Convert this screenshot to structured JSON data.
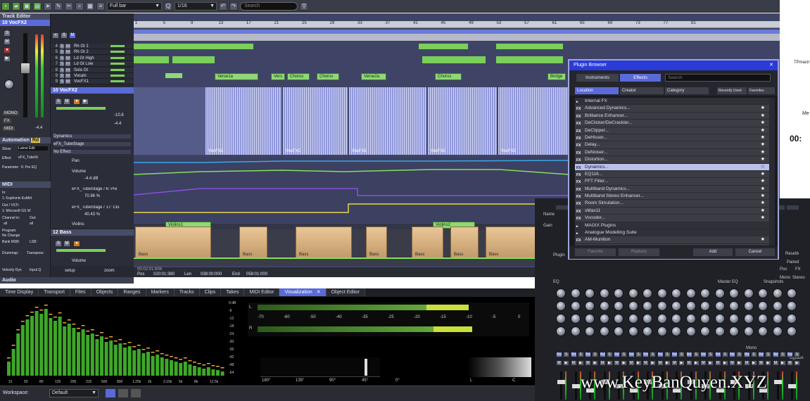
{
  "toolbar": {
    "snap_mode": "Full bar",
    "quantize": "1/16",
    "search_placeholder": "Search"
  },
  "track_editor": {
    "title": "Track Editor",
    "selected_track_num": "10",
    "selected_track_name": "VocFX2",
    "vol_value": "-4.4",
    "btn_mono": "MONO",
    "btn_fx": "FX",
    "btn_midi": "MIDI"
  },
  "ruler": {
    "bars": [
      "1",
      "5",
      "9",
      "13",
      "17",
      "21",
      "25",
      "29",
      "33",
      "37",
      "41",
      "45",
      "49",
      "53",
      "57",
      "61",
      "65",
      "69",
      "73",
      "77",
      "81"
    ]
  },
  "tracks": [
    {
      "num": "4",
      "name": "Rh Gt 1"
    },
    {
      "num": "5",
      "name": "Rh Gt 2"
    },
    {
      "num": "6",
      "name": "Ld Gt High"
    },
    {
      "num": "7",
      "name": "Ld Gt Low"
    },
    {
      "num": "8",
      "name": "Solo Gt"
    },
    {
      "num": "9",
      "name": "Vocals"
    },
    {
      "num": "9",
      "name": "VocFX1"
    }
  ],
  "parts": [
    "Verse1a",
    "Vers",
    "Chorus",
    "Chorus",
    "Verse2a",
    "Chorus",
    "Bridge"
  ],
  "voc_track": {
    "num": "10",
    "name": "VocFX2",
    "dynamics": "Dynamics",
    "plugin": "eFX_TubeStage",
    "no_effect": "No Effect",
    "pan": "Pan",
    "volume": "Volume",
    "vol_db": "-4.4 dB",
    "pre1": "eFX_TubeStage / 6: Pre",
    "pre1_val": "70.96 %",
    "pre2": "eFX_TubeStage / 17: Clo",
    "pre2_val": "40.43 %",
    "vol_fader": "-10.8",
    "vol_fader2": "-4.4",
    "clip_labels": [
      "VocFX2",
      "VocFX2",
      "VocFX2",
      "VocFX2",
      "VocFX2"
    ]
  },
  "violins": {
    "name": "Violins",
    "clips": [
      "Violins1",
      "Violins2"
    ]
  },
  "bass": {
    "num": "12",
    "name": "Bass",
    "volume": "Volume",
    "clip_label": "Bass"
  },
  "automation": {
    "title": "Automation",
    "mode": "Rd",
    "show_label": "Show",
    "show_val": "Latest Edit",
    "effect_label": "Effect",
    "effect_val": "eFX_TubeSt",
    "param_label": "Parameter",
    "param_val": "6: Pre EQ"
  },
  "midi": {
    "title": "MIDI",
    "in_label": "In:",
    "in_val": "1: Euphonix EuMid",
    "out_label": "Out / VSTi:",
    "out_val": "1: Microsoft GS W",
    "channel_in": "Channel in:",
    "channel_out": "Out:",
    "ch_in_val": "all",
    "ch_out_val": "all",
    "program": "Program:",
    "program_val": "No Change",
    "bank_msb": "Bank MSB:",
    "bank_lsb": "LSB:",
    "drummap": "Drummap:",
    "transpose": "Transpose:",
    "velocity": "Velocity Dyn",
    "input_q": "Input Q",
    "setup": "setup",
    "zoom": "zoom"
  },
  "audio_title": "Audio",
  "position": {
    "pos_label": "Pos",
    "pos_val": "020:01:380",
    "len_label": "Len",
    "len_val": "038:00:000",
    "end_label": "End",
    "end_val": "058:01:000",
    "time": "00:02:01:606"
  },
  "bottom_tabs": [
    "Time Display",
    "Transport",
    "Files",
    "Objects",
    "Ranges",
    "Markers",
    "Tracks",
    "Clips",
    "Takes",
    "MIDI Editor",
    "Visualization",
    "Object Editor"
  ],
  "active_tab": "Visualization",
  "meter_scale": [
    "-70",
    "-60",
    "-50",
    "-40",
    "-35",
    "-25",
    "-20",
    "-15",
    "-10",
    "-5",
    "0"
  ],
  "meter_L": "L",
  "meter_R": "R",
  "spectrum_freqs": [
    "31",
    "50",
    "80",
    "125",
    "200",
    "315",
    "500",
    "800",
    "1.25k",
    "2k",
    "3.15k",
    "5k",
    "8k",
    "12.5k"
  ],
  "spectrum_scale": [
    "0 dB",
    "-6",
    "-12",
    "-18",
    "-24",
    "-30",
    "-36",
    "-42",
    "-48",
    "-54"
  ],
  "phase_scale": [
    "180°",
    "135°",
    "90°",
    "45°",
    "0°",
    "L",
    "C"
  ],
  "workspace": {
    "label": "Workspace:",
    "value": "Default"
  },
  "plugin_browser": {
    "title": "Plugin Browser",
    "tabs": [
      "Instruments",
      "Effects"
    ],
    "search_placeholder": "Search",
    "cols": [
      "Location",
      "Creator",
      "Category"
    ],
    "right_tabs": [
      "Recently Used",
      "Favorites"
    ],
    "items": [
      "Internal FX",
      "Advanced Dynamics...",
      "Brilliance Enhancer...",
      "DeClicker/DeCrackler...",
      "DeClipper...",
      "DeHisser...",
      "Delay...",
      "DeNoiser...",
      "Distortion...",
      "Dynamics...",
      "EQ116...",
      "FFT Filter...",
      "Multiband Dynamics...",
      "Multiband Stereo Enhancer...",
      "Room Simulation...",
      "sMax11",
      "Vocoder...",
      "MAGIX Plugins",
      "Analogue Modelling Suite",
      "AM-Munition"
    ],
    "selected": "Dynamics...",
    "buttons": [
      "Favorite",
      "Replace",
      "Add",
      "Cancel"
    ]
  },
  "side_text": {
    "brand": "TPmacir",
    "time": "00:",
    "label": "Me"
  },
  "mixer": {
    "labels": [
      "Name",
      "Gain",
      "Plugin",
      "EQ",
      "Master EQ",
      "Snapshots",
      "Mono",
      "Stereo",
      "FX",
      "Pos",
      "Paired",
      "Bypass",
      "Mono",
      "Resetb"
    ]
  },
  "watermark": "www.KeyBanQuyen.XYZ",
  "colors": {
    "accent": "#5a6ad8",
    "green": "#7ccf5b",
    "waveform": "#9aa2e8",
    "bass": "#d9b486"
  }
}
